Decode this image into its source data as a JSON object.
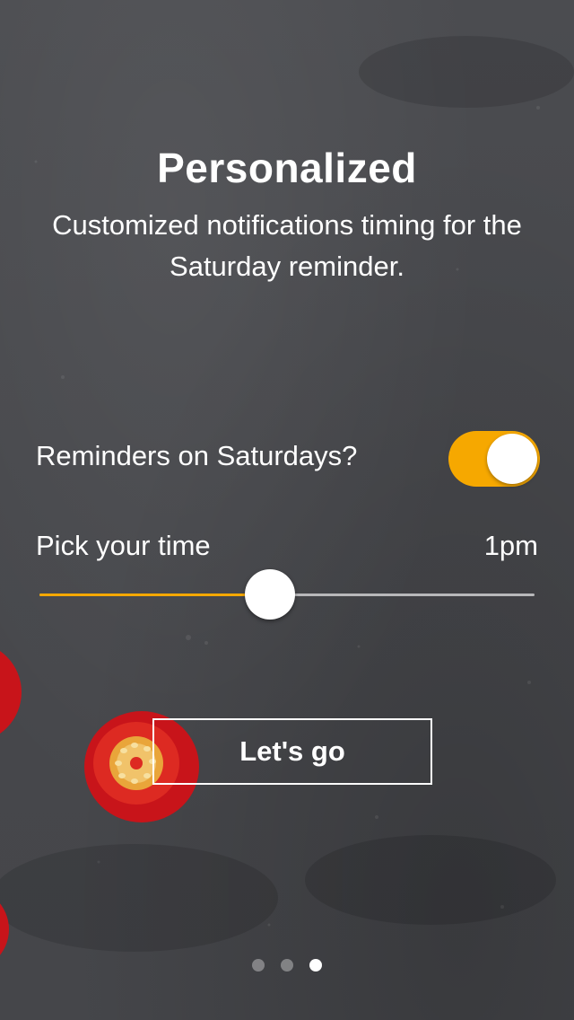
{
  "header": {
    "title": "Personalized",
    "subtitle": "Customized notifications timing for the Saturday reminder."
  },
  "settings": {
    "reminder_label": "Reminders on Saturdays?",
    "reminder_enabled": true,
    "time_label": "Pick your time",
    "time_value": "1pm",
    "time_slider_fraction": 0.465
  },
  "cta": {
    "label": "Let's go"
  },
  "pager": {
    "pages": 3,
    "current": 3
  },
  "colors": {
    "accent": "#f6a800",
    "background": "#4a4b4f",
    "tomato": "#c8141a"
  },
  "icons": {
    "decoration": "cherry-tomato"
  }
}
